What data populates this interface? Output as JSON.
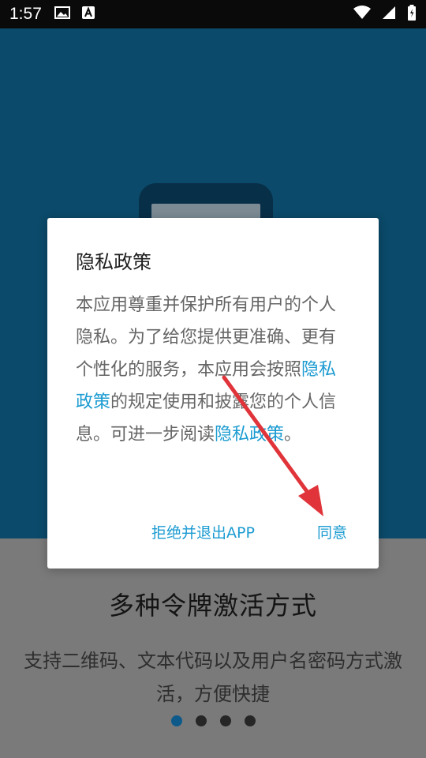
{
  "statusbar": {
    "time": "1:57",
    "icons_left": [
      "image-icon",
      "a-badge-icon"
    ],
    "icons_right": [
      "wifi-icon",
      "signal-icon",
      "battery-icon"
    ]
  },
  "onboarding": {
    "title": "多种令牌激活方式",
    "description": "支持二维码、文本代码以及用户名密码方式激活，方便快捷",
    "pagination": {
      "total": 4,
      "active_index": 0
    }
  },
  "dialog": {
    "title": "隐私政策",
    "body": {
      "part1": "本应用尊重并保护所有用户的个人隐私。为了给您提供更准确、更有个性化的服务，本应用会按照",
      "link1": "隐私政策",
      "part2": "的规定使用和披露您的个人信息。可进一步阅读",
      "link2": "隐私政策",
      "part3": "。"
    },
    "decline_label": "拒绝并退出APP",
    "agree_label": "同意"
  },
  "colors": {
    "top_background": "#0b4a6a",
    "link": "#1b9bd1",
    "annotation_arrow": "#e0343a",
    "active_dot": "#0d5a8a"
  }
}
